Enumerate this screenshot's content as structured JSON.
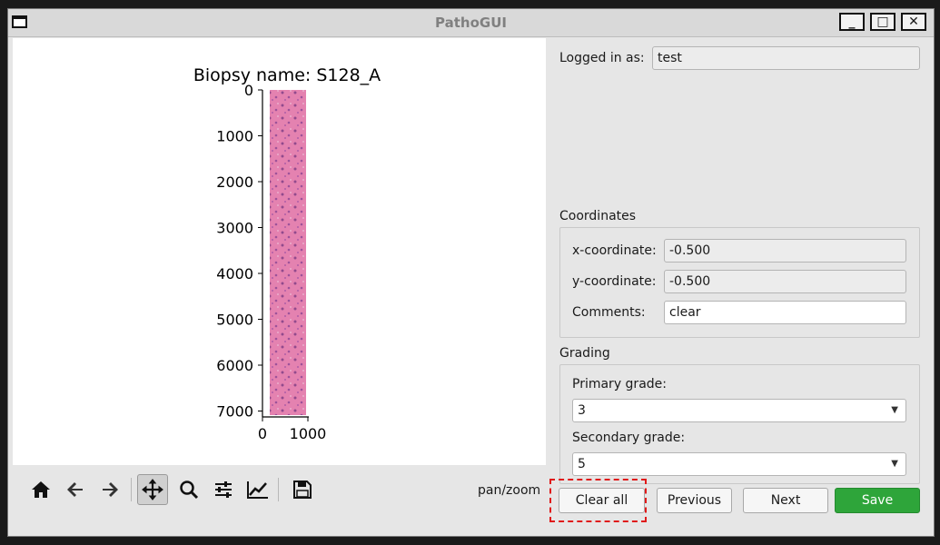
{
  "window": {
    "title": "PathoGUI"
  },
  "plot": {
    "title": "Biopsy name: S128_A",
    "yticks": [
      "0",
      "1000",
      "2000",
      "3000",
      "4000",
      "5000",
      "6000",
      "7000"
    ],
    "xticks": [
      "0",
      "1000"
    ],
    "mode_label": "pan/zoom"
  },
  "toolbar": {
    "buttons": [
      {
        "name": "home-icon"
      },
      {
        "name": "back-arrow-icon"
      },
      {
        "name": "forward-arrow-icon"
      },
      {
        "name": "pan-icon"
      },
      {
        "name": "zoom-icon"
      },
      {
        "name": "configure-subplots-icon"
      },
      {
        "name": "edit-axis-icon"
      },
      {
        "name": "save-figure-icon"
      }
    ]
  },
  "login": {
    "label": "Logged in as:",
    "value": "test"
  },
  "coordinates": {
    "section": "Coordinates",
    "x_label": "x-coordinate:",
    "x_value": "-0.500",
    "y_label": "y-coordinate:",
    "y_value": "-0.500",
    "comments_label": "Comments:",
    "comments_value": "clear"
  },
  "grading": {
    "section": "Grading",
    "primary_label": "Primary grade:",
    "primary_value": "3",
    "secondary_label": "Secondary grade:",
    "secondary_value": "5"
  },
  "buttons": {
    "clear": "Clear all",
    "previous": "Previous",
    "next": "Next",
    "save": "Save"
  },
  "colors": {
    "save": "#2ea53a",
    "highlight": "#e01a1a",
    "tissue": "#e07aa8"
  }
}
